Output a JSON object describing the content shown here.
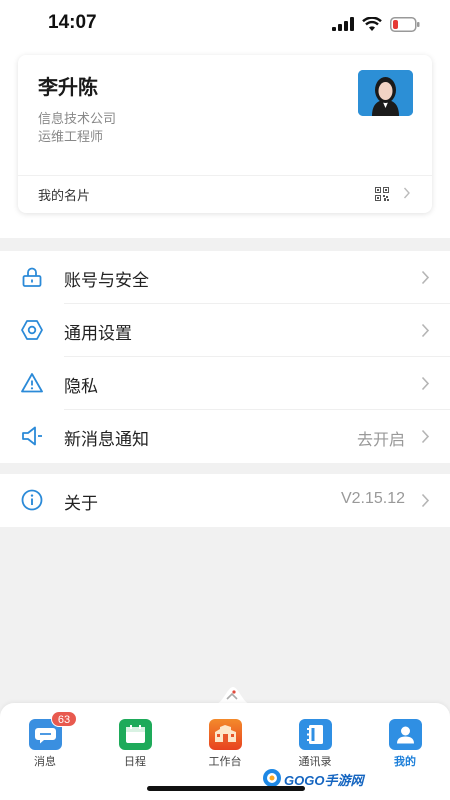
{
  "status_bar": {
    "time": "14:07",
    "icons": [
      "signal-icon",
      "wifi-icon",
      "battery-low-icon"
    ],
    "battery_color": "#e53935"
  },
  "profile": {
    "name": "李升陈",
    "company": "信息技术公司",
    "title": "运维工程师",
    "card_link_label": "我的名片",
    "avatar_bg": "#2c8fd6"
  },
  "menu": {
    "group1": [
      {
        "label": "账号与安全",
        "value": "",
        "icon": "lock-icon"
      },
      {
        "label": "通用设置",
        "value": "",
        "icon": "gear-icon"
      },
      {
        "label": "隐私",
        "value": "",
        "icon": "warning-icon"
      },
      {
        "label": "新消息通知",
        "value": "去开启",
        "icon": "speaker-icon"
      }
    ],
    "group2": [
      {
        "label": "关于",
        "value": "V2.15.12",
        "icon": "info-icon"
      }
    ]
  },
  "colors": {
    "accent": "#1d7fd9",
    "icon_blue": "#2b8ad8",
    "badge_red": "#e85a4f"
  },
  "tabbar": {
    "tabs": [
      {
        "label": "消息",
        "icon": "chat-bubble-icon",
        "color": "#3a8fe0",
        "badge": "63"
      },
      {
        "label": "日程",
        "icon": "calendar-icon",
        "color": "#1eaa5a",
        "badge": ""
      },
      {
        "label": "工作台",
        "icon": "building-icon",
        "color": "#f0681f",
        "badge": ""
      },
      {
        "label": "通讯录",
        "icon": "contacts-book-icon",
        "color": "#2f8fe3",
        "badge": ""
      },
      {
        "label": "我的",
        "icon": "person-icon",
        "color": "#2f8fe3",
        "badge": "",
        "active": true
      }
    ]
  },
  "watermark": {
    "text": "GOGO手游网"
  }
}
